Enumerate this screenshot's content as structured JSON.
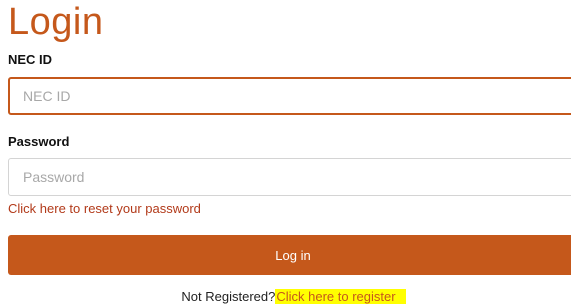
{
  "page_title": "Login",
  "nec_id": {
    "label": "NEC ID",
    "placeholder": "NEC ID",
    "value": ""
  },
  "password": {
    "label": "Password",
    "placeholder": "Password",
    "value": ""
  },
  "reset_link": "Click here to reset your password",
  "login_button": "Log in",
  "register": {
    "prompt": "Not Registered?",
    "link": "Click here to register"
  },
  "colors": {
    "accent": "#c5581b",
    "link_red": "#b23a1a",
    "highlight": "#ffff00"
  }
}
